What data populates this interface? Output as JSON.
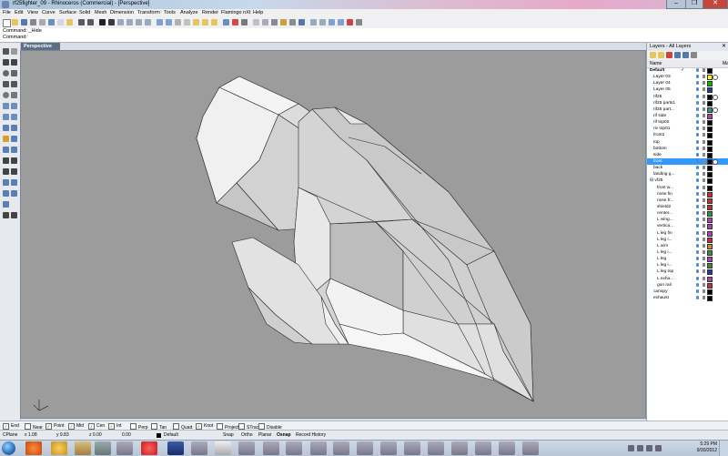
{
  "window": {
    "title": "rf25fighter_09 - Rhinoceros (Commercial) - [Perspective]",
    "controls": [
      "–",
      "❐",
      "✕"
    ]
  },
  "menubar": [
    "File",
    "Edit",
    "View",
    "Curve",
    "Surface",
    "Solid",
    "Mesh",
    "Dimension",
    "Transform",
    "Tools",
    "Analyze",
    "Render",
    "Flamingo nXt",
    "Help"
  ],
  "command": {
    "history": "Command: _Hide",
    "prompt": "Command:"
  },
  "viewport": {
    "label": "Perspective",
    "background": "#9c9c9c"
  },
  "layers": {
    "title": "Layers - All Layers",
    "close": "✕",
    "headers": {
      "name": "Name",
      "mat": "Ma"
    },
    "items": [
      {
        "name": "Default",
        "indent": 0,
        "bold": true,
        "check": "✓",
        "color": "#000000",
        "mat": false,
        "sel": false
      },
      {
        "name": "Layer 03",
        "indent": 1,
        "color": "#ffff00",
        "mat": true,
        "sel": false
      },
      {
        "name": "Layer 04",
        "indent": 1,
        "color": "#00c000",
        "mat": false,
        "sel": false
      },
      {
        "name": "Layer 05",
        "indent": 1,
        "color": "#1a3fa0",
        "mat": false,
        "sel": false
      },
      {
        "name": "rif25",
        "indent": 1,
        "color": "#000000",
        "mat": true,
        "sel": false
      },
      {
        "name": "rif25 parts1",
        "indent": 1,
        "color": "#000000",
        "mat": false,
        "sel": false
      },
      {
        "name": "rif25 part...",
        "indent": 1,
        "color": "#3a8c8c",
        "mat": true,
        "sel": false
      },
      {
        "name": "rif side",
        "indent": 1,
        "color": "#b040b0",
        "mat": false,
        "sel": false
      },
      {
        "name": "rif top02",
        "indent": 1,
        "color": "#000000",
        "mat": false,
        "sel": false
      },
      {
        "name": "riv top01",
        "indent": 1,
        "color": "#000000",
        "mat": false,
        "sel": false
      },
      {
        "name": "front2",
        "indent": 1,
        "color": "#000000",
        "mat": false,
        "sel": false
      },
      {
        "name": "top",
        "indent": 1,
        "color": "#000000",
        "mat": false,
        "sel": false
      },
      {
        "name": "bottom",
        "indent": 1,
        "color": "#000000",
        "mat": false,
        "sel": false
      },
      {
        "name": "side",
        "indent": 1,
        "color": "#000000",
        "mat": false,
        "sel": false
      },
      {
        "name": "front",
        "indent": 1,
        "color": "#000000",
        "mat": true,
        "sel": true
      },
      {
        "name": "back",
        "indent": 1,
        "color": "#000000",
        "mat": false,
        "sel": false
      },
      {
        "name": "landing g...",
        "indent": 1,
        "color": "#000000",
        "mat": false,
        "sel": false
      },
      {
        "name": "⊟ vf25",
        "indent": 0,
        "color": "#000000",
        "mat": false,
        "sel": false
      },
      {
        "name": "front w...",
        "indent": 2,
        "color": "#000000",
        "mat": false,
        "sel": false
      },
      {
        "name": "nose fin",
        "indent": 2,
        "color": "#c03030",
        "mat": false,
        "sel": false
      },
      {
        "name": "nose fr...",
        "indent": 2,
        "color": "#c03030",
        "mat": false,
        "sel": false
      },
      {
        "name": "shield2",
        "indent": 2,
        "color": "#c03030",
        "mat": false,
        "sel": false
      },
      {
        "name": "center...",
        "indent": 2,
        "color": "#3a8c3a",
        "mat": false,
        "sel": false
      },
      {
        "name": "L wing...",
        "indent": 2,
        "color": "#b040b0",
        "mat": false,
        "sel": false
      },
      {
        "name": "vertica...",
        "indent": 2,
        "color": "#b040b0",
        "mat": false,
        "sel": false
      },
      {
        "name": "L leg fin",
        "indent": 2,
        "color": "#b040b0",
        "mat": false,
        "sel": false
      },
      {
        "name": "L leg i...",
        "indent": 2,
        "color": "#c03030",
        "mat": false,
        "sel": false
      },
      {
        "name": "L arm",
        "indent": 2,
        "color": "#c09030",
        "mat": false,
        "sel": false
      },
      {
        "name": "L leg i...",
        "indent": 2,
        "color": "#3a8c3a",
        "mat": false,
        "sel": false
      },
      {
        "name": "L leg",
        "indent": 2,
        "color": "#b040b0",
        "mat": false,
        "sel": false
      },
      {
        "name": "L leg i...",
        "indent": 2,
        "color": "#3a8c3a",
        "mat": false,
        "sel": false
      },
      {
        "name": "L leg top",
        "indent": 2,
        "color": "#1a3fa0",
        "mat": false,
        "sel": false
      },
      {
        "name": "L exha...",
        "indent": 2,
        "color": "#b040b0",
        "mat": false,
        "sel": false
      },
      {
        "name": "gun rail",
        "indent": 2,
        "color": "#c03030",
        "mat": false,
        "sel": false
      },
      {
        "name": "canopy",
        "indent": 1,
        "color": "#000000",
        "mat": false,
        "sel": false
      },
      {
        "name": "exhaust",
        "indent": 1,
        "color": "#000000",
        "mat": false,
        "sel": false
      }
    ]
  },
  "osnap": [
    {
      "label": "End",
      "checked": true
    },
    {
      "label": "Near",
      "checked": false
    },
    {
      "label": "Point",
      "checked": true
    },
    {
      "label": "Mid",
      "checked": true
    },
    {
      "label": "Cen",
      "checked": true
    },
    {
      "label": "Int",
      "checked": true
    },
    {
      "label": "Perp",
      "checked": false
    },
    {
      "label": "Tan",
      "checked": false
    },
    {
      "label": "Quad",
      "checked": false
    },
    {
      "label": "Knot",
      "checked": true
    },
    {
      "label": "Project",
      "checked": false
    },
    {
      "label": "STrack",
      "checked": false
    },
    {
      "label": "Disable",
      "checked": false
    }
  ],
  "status": {
    "cplane": "CPlane",
    "x": "x 1.08",
    "y": "y 9.83",
    "z": "z 0.00",
    "extra": "0.00",
    "layer": "Default",
    "panes": [
      "Snap",
      "Ortho",
      "Planar",
      "Osnap",
      "Record History"
    ]
  },
  "taskbar": {
    "time": "5:29 PM",
    "date": "9/30/2012"
  },
  "colors": {
    "selection": "#3399ff",
    "viewport_tab": "#5c6f84"
  }
}
